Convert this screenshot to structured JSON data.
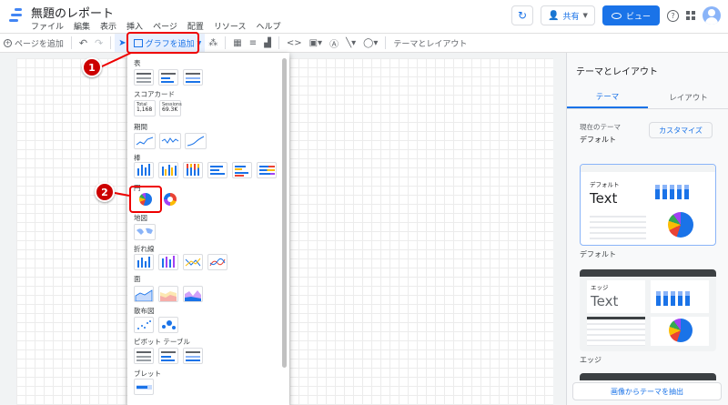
{
  "app": {
    "title": "無題のレポート",
    "menu": [
      "ファイル",
      "編集",
      "表示",
      "挿入",
      "ページ",
      "配置",
      "リソース",
      "ヘルプ"
    ],
    "share_label": "共有",
    "view_label": "ビュー"
  },
  "toolbar": {
    "add_page": "ページを追加",
    "add_chart": "グラフを追加",
    "theme_layout": "テーマとレイアウト"
  },
  "chart_menu": {
    "categories": {
      "table": "表",
      "scorecard": "スコアカード",
      "timeseries": "期間",
      "bar": "棒",
      "pie": "円",
      "geo": "地図",
      "line": "折れ線",
      "area": "面",
      "scatter": "散布図",
      "pivot": "ピボット テーブル",
      "bullet": "ブレット"
    },
    "scorecard1": {
      "label": "Total",
      "value": "1,168"
    },
    "scorecard2": {
      "label": "Sessions",
      "value": "69.3K"
    }
  },
  "annotations": {
    "badge1": "1",
    "badge2": "2"
  },
  "right_panel": {
    "title": "テーマとレイアウト",
    "tab_theme": "テーマ",
    "tab_layout": "レイアウト",
    "current_theme_label": "現在のテーマ",
    "current_theme_value": "デフォルト",
    "customize_button": "カスタマイズ",
    "theme1": {
      "header": "デフォルト",
      "text": "Text",
      "caption": "デフォルト"
    },
    "theme2": {
      "header": "エッジ",
      "text": "Text",
      "caption": "エッジ"
    },
    "extract_button": "画像からテーマを抽出"
  },
  "colors": {
    "accent": "#1a73e8",
    "annotation": "#cc0000"
  }
}
